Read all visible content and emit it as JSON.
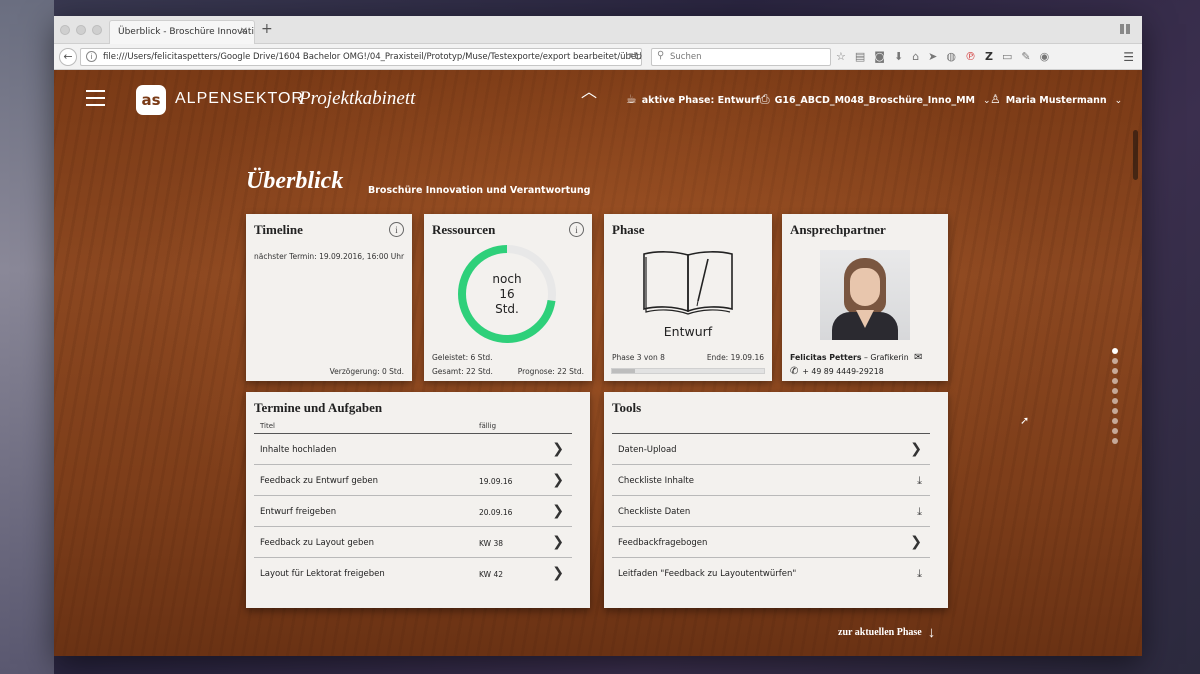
{
  "browser": {
    "tab_title": "Überblick - Broschüre Innovatio…",
    "url": "file:///Users/felicitaspetters/Google Drive/1604 Bachelor OMG!/04_Praxisteil/Prototyp/Muse/Testexporte/export bearbeitet/überblick",
    "search_placeholder": "Suchen"
  },
  "app": {
    "brand": "ALPENSEKTOR",
    "product": "Projektkabinett",
    "logo_letters": "as",
    "active_phase": "aktive Phase: Entwurf",
    "project": "G16_ABCD_M048_Broschüre_Inno_MM",
    "user": "Maria Mustermann"
  },
  "page": {
    "title": "Überblick",
    "subtitle": "Broschüre Innovation und Verantwortung"
  },
  "timeline": {
    "title": "Timeline",
    "next_date": "nächster Termin: 19.09.2016, 16:00 Uhr",
    "delay": "Verzögerung: 0 Std."
  },
  "resources": {
    "title": "Ressourcen",
    "ring_line1": "noch",
    "ring_line2": "16",
    "ring_line3": "Std.",
    "done": "Geleistet: 6 Std.",
    "total": "Gesamt: 22 Std.",
    "forecast": "Prognose: 22 Std.",
    "remaining_fraction": 0.727,
    "ring_color": "#2ed07a"
  },
  "phase": {
    "title": "Phase",
    "name": "Entwurf",
    "progress_label": "Phase 3 von 8",
    "end_label": "Ende: 19.09.16",
    "progress_fraction": 0.15
  },
  "contact": {
    "title": "Ansprechpartner",
    "name": "Felicitas Petters",
    "role": " – Grafikerin",
    "phone": "+ 49 89 4449-29218"
  },
  "tasks": {
    "title": "Termine und Aufgaben",
    "col_title": "Titel",
    "col_due": "fällig",
    "rows": [
      {
        "label": "Inhalte hochladen",
        "due": ""
      },
      {
        "label": "Feedback zu Entwurf geben",
        "due": "19.09.16"
      },
      {
        "label": "Entwurf freigeben",
        "due": "20.09.16"
      },
      {
        "label": "Feedback zu Layout geben",
        "due": "KW 38"
      },
      {
        "label": "Layout für Lektorat freigeben",
        "due": "KW 42"
      }
    ]
  },
  "tools": {
    "title": "Tools",
    "rows": [
      {
        "label": "Daten-Upload",
        "icon": "arrow-right-icon"
      },
      {
        "label": "Checkliste Inhalte",
        "icon": "download-icon"
      },
      {
        "label": "Checkliste Daten",
        "icon": "download-icon"
      },
      {
        "label": "Feedbackfragebogen",
        "icon": "arrow-right-icon"
      },
      {
        "label": "Leitfaden \"Feedback zu Layoutentwürfen\"",
        "icon": "download-icon"
      }
    ]
  },
  "footer": {
    "next_phase": "zur aktuellen Phase"
  }
}
